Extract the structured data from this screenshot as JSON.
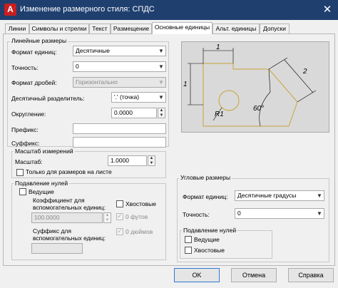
{
  "window": {
    "title": "Изменение размерного стиля: СПДС",
    "logo": "A",
    "close_icon": "close-icon"
  },
  "tabs": [
    {
      "label": "Линии"
    },
    {
      "label": "Символы и стрелки"
    },
    {
      "label": "Текст"
    },
    {
      "label": "Размещение"
    },
    {
      "label": "Основные единицы",
      "active": true
    },
    {
      "label": "Альт. единицы"
    },
    {
      "label": "Допуски"
    }
  ],
  "linear": {
    "group_label": "Линейные размеры",
    "unit_format_label": "Формат единиц:",
    "unit_format_value": "Десятичные",
    "precision_label": "Точность:",
    "precision_value": "0",
    "fraction_format_label": "Формат дробей:",
    "fraction_format_value": "Горизонтально",
    "decimal_separator_label": "Десятичный разделитель:",
    "decimal_separator_value": "'.' (точка)",
    "round_off_label": "Округление:",
    "round_off_value": "0.0000",
    "prefix_label": "Префикс:",
    "prefix_value": "",
    "suffix_label": "Суффикс:",
    "suffix_value": ""
  },
  "measurement_scale": {
    "group_label": "Масштаб измерений",
    "scale_factor_label": "Масштаб:",
    "scale_factor_value": "1.0000",
    "layout_only_label": "Только для размеров на листе",
    "layout_only_checked": false
  },
  "zero_suppression": {
    "group_label": "Подавление нулей",
    "leading_label": "Ведущие",
    "leading_checked": false,
    "sub_unit_factor_label": "Коэффициент для вспомогательных единиц:",
    "sub_unit_factor_value": "100.0000",
    "trailing_label": "Хвостовые",
    "trailing_checked": false,
    "zero_feet_label": "0 футов",
    "zero_inches_label": "0 дюймов",
    "sub_unit_suffix_label": "Суффикс для вспомогательных единиц:",
    "sub_unit_suffix_value": ""
  },
  "angular": {
    "group_label": "Угловые размеры",
    "unit_format_label": "Формат единиц:",
    "unit_format_value": "Десятичные градусы",
    "precision_label": "Точность:",
    "precision_value": "0",
    "zero_group_label": "Подавление нулей",
    "leading_label": "Ведущие",
    "leading_checked": false,
    "trailing_label": "Хвостовые",
    "trailing_checked": false
  },
  "preview": {
    "dim_top": "1",
    "dim_left": "1",
    "dim_right": "2",
    "dim_radius": "R1",
    "dim_angle": "60°"
  },
  "buttons": {
    "ok": "OK",
    "cancel": "Отмена",
    "help": "Справка"
  },
  "colors": {
    "titlebar": "#1f3f6f",
    "logo": "#c81e1e",
    "preview_bg": "#d9d9d9",
    "shape": "#c8a43c",
    "default_button_border": "#2f78d8"
  }
}
